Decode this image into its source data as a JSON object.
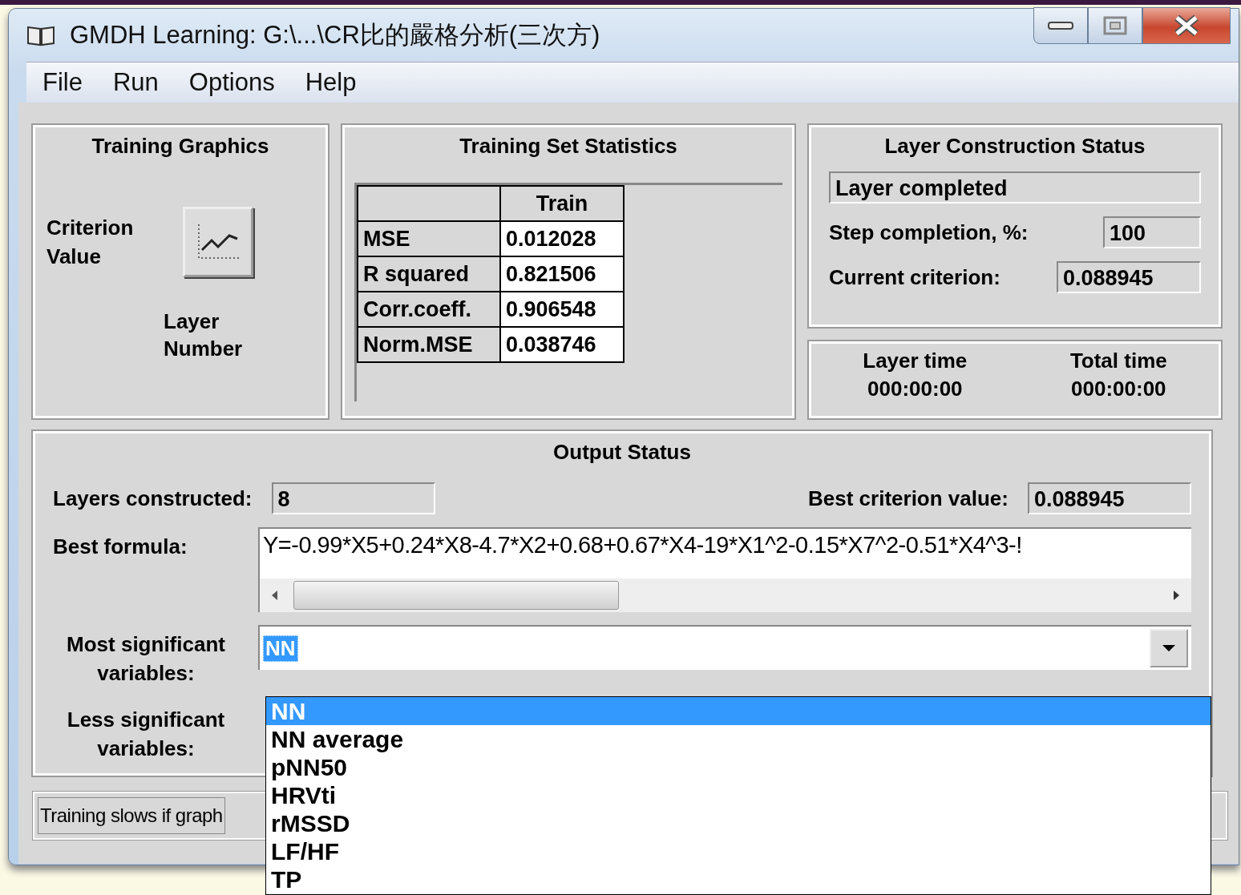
{
  "window": {
    "title": "GMDH Learning: G:\\...\\CR比的嚴格分析(三次方)"
  },
  "menu": [
    "File",
    "Run",
    "Options",
    "Help"
  ],
  "training_graphics": {
    "title": "Training Graphics",
    "y_label": "Criterion Value",
    "x_label": "Layer Number"
  },
  "training_set_statistics": {
    "title": "Training Set Statistics",
    "column": "Train",
    "rows": [
      {
        "name": "MSE",
        "value": "0.012028"
      },
      {
        "name": "R squared",
        "value": "0.821506"
      },
      {
        "name": "Corr.coeff.",
        "value": "0.906548"
      },
      {
        "name": "Norm.MSE",
        "value": "0.038746"
      }
    ]
  },
  "layer_construction_status": {
    "title": "Layer Construction Status",
    "status": "Layer completed",
    "step_label": "Step completion, %:",
    "step_value": "100",
    "criterion_label": "Current criterion:",
    "criterion_value": "0.088945"
  },
  "times": [
    {
      "label": "Layer time",
      "value": "000:00:00"
    },
    {
      "label": "Total time",
      "value": "000:00:00"
    }
  ],
  "output_status": {
    "title": "Output Status",
    "layers_label": "Layers constructed:",
    "layers_value": "8",
    "best_label": "Best criterion value:",
    "best_value": "0.088945",
    "formula_label": "Best formula:",
    "formula_value": "Y=-0.99*X5+0.24*X8-4.7*X2+0.68+0.67*X4-19*X1^2-0.15*X7^2-0.51*X4^3-!",
    "most_label": "Most significant variables:",
    "most_value": "NN",
    "less_label": "Less significant variables:"
  },
  "dropdown_options": [
    {
      "label": "NN",
      "selected": true
    },
    {
      "label": "NN average",
      "selected": false
    },
    {
      "label": "pNN50",
      "selected": false
    },
    {
      "label": "HRVti",
      "selected": false
    },
    {
      "label": "rMSSD",
      "selected": false
    },
    {
      "label": "LF/HF",
      "selected": false
    },
    {
      "label": "TP",
      "selected": false
    }
  ],
  "status_bar": "Training slows if graph"
}
